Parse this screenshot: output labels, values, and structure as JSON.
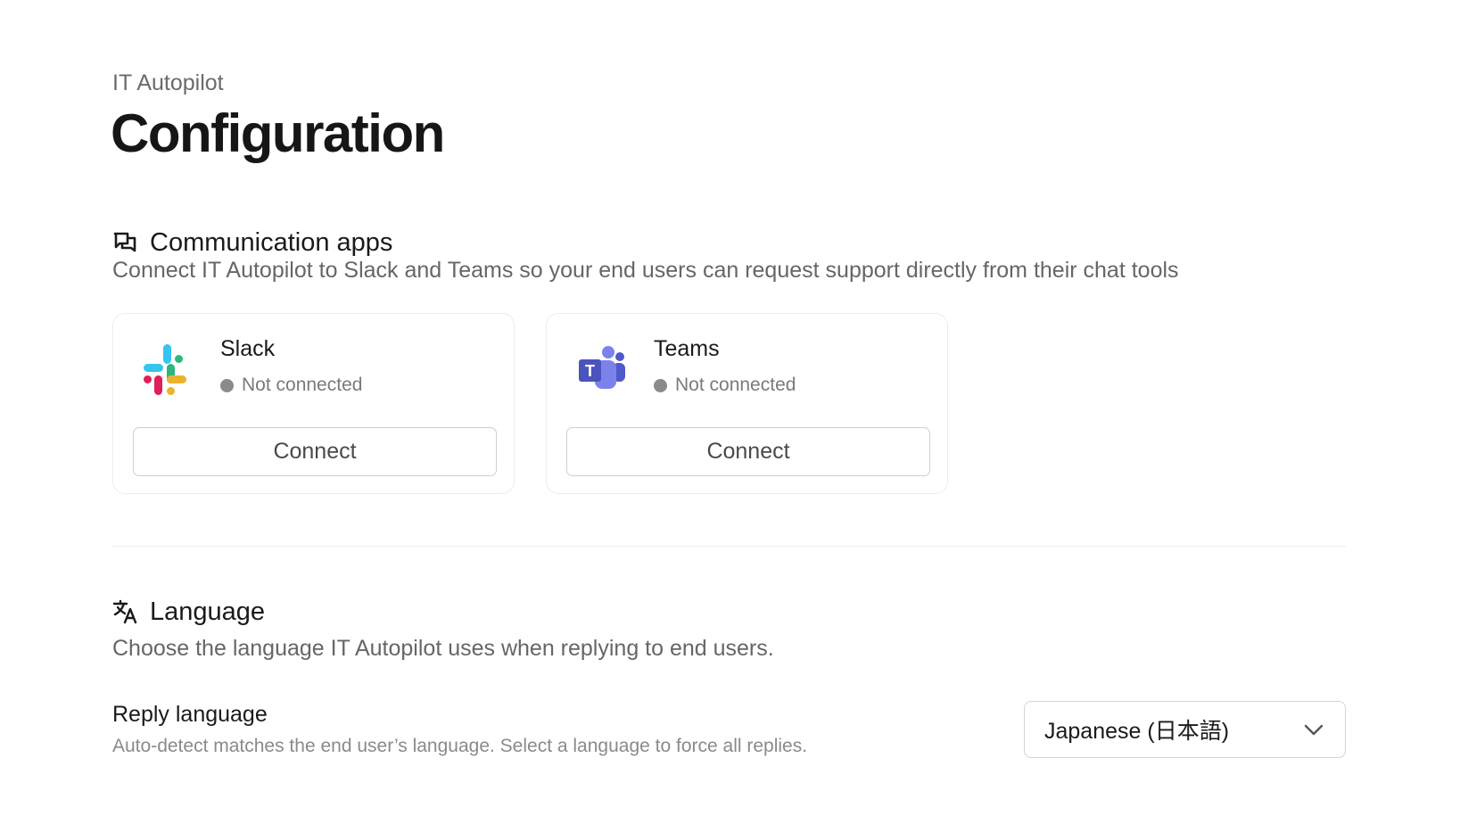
{
  "header": {
    "eyebrow": "IT Autopilot",
    "title": "Configuration"
  },
  "communication": {
    "icon": "chat-bubbles-icon",
    "title": "Communication apps",
    "description": "Connect IT Autopilot to Slack and Teams so your end users can request support directly from their chat tools",
    "apps": [
      {
        "name": "Slack",
        "icon": "slack-logo-icon",
        "status": "Not connected",
        "button": "Connect"
      },
      {
        "name": "Teams",
        "icon": "teams-logo-icon",
        "status": "Not connected",
        "button": "Connect"
      }
    ]
  },
  "language": {
    "icon": "translate-icon",
    "title": "Language",
    "description": "Choose the language IT Autopilot uses when replying to end users.",
    "reply": {
      "label": "Reply language",
      "help": "Auto-detect matches the end user’s language. Select a language to force all replies.",
      "selected": "Japanese (日本語)"
    }
  },
  "colors": {
    "status_dot": "#8a8a8a",
    "slack_blue": "#36C5F0",
    "slack_green": "#2EB67D",
    "slack_red": "#E01E5A",
    "slack_yellow": "#ECB22E",
    "teams_purple": "#5B5FC7"
  }
}
